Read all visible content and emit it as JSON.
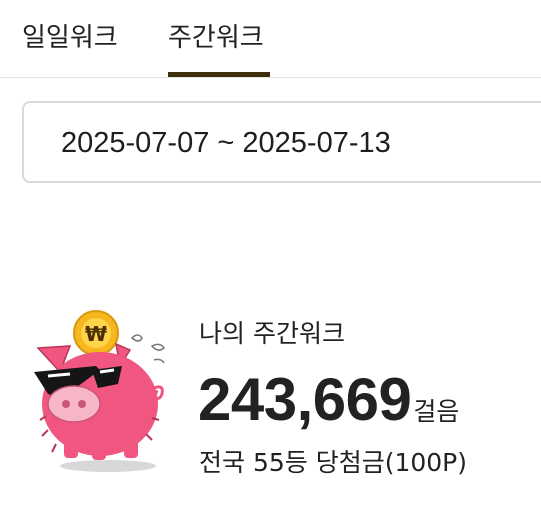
{
  "tabs": [
    {
      "label": "일일워크",
      "active": false
    },
    {
      "label": "주간워크",
      "active": true
    }
  ],
  "colors": {
    "tab_underline": "#3d2f0c",
    "pig_pink": "#f0567f",
    "coin_gold": "#f6b820"
  },
  "date_range": {
    "text": "2025-07-07 ~ 2025-07-13"
  },
  "summary": {
    "label": "나의 주간워크",
    "steps": "243,669",
    "steps_unit": "걸음",
    "rank_text": "전국 55등 당첨금(100P)"
  },
  "mascot": {
    "icon": "piggy-bank-coin-icon",
    "coin_symbol": "₩"
  }
}
